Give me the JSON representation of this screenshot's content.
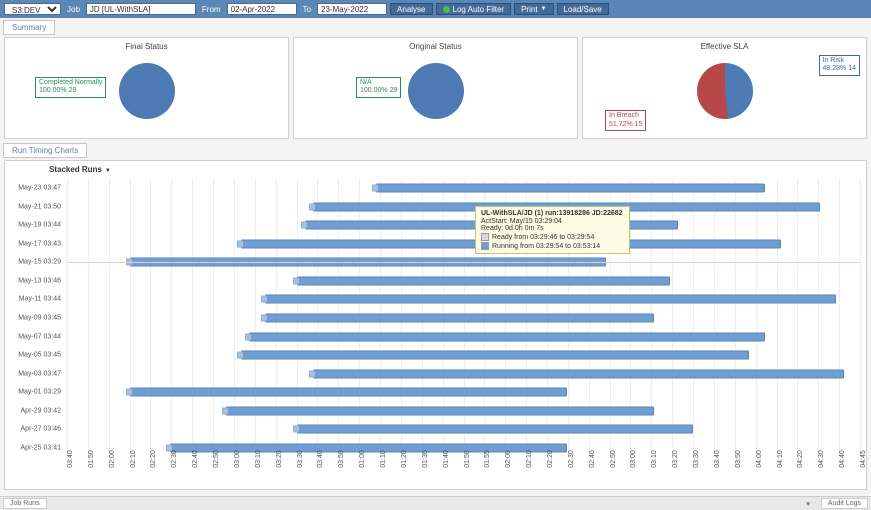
{
  "toolbar": {
    "env_value": "S3:DEV",
    "job_lbl": "Job",
    "job_value": "JD [UL-WithSLA]",
    "from_lbl": "From",
    "from_value": "02-Apr-2022",
    "to_lbl": "To",
    "to_value": "23-May-2022",
    "analyse": "Analyse",
    "autofilter": "Log Auto Filter",
    "print": "Print",
    "loadsave": "Load/Save"
  },
  "tabs": {
    "summary": "Summary",
    "runtiming": "Run Timing Charts"
  },
  "panels": {
    "final": {
      "title": "Final Status",
      "label": "Completed Normally\n100.00% 29",
      "label_color": "#2e8b57"
    },
    "original": {
      "title": "Original Status",
      "label": "N/A\n100.00% 29",
      "label_color": "#2e8b57"
    },
    "sla": {
      "title": "Effective SLA",
      "label_top": "In Risk\n48.28% 14",
      "label_top_color": "#3c68a6",
      "label_bot": "In Breach\n51.72% 15",
      "label_bot_color": "#b84848"
    }
  },
  "chart": {
    "title": "Stacked Runs"
  },
  "tooltip": {
    "title": "UL-WithSLA/JD (1) run:13918286 JD:22682",
    "l1": "ActStart: May/15 03:29:04",
    "l2": "Ready:    0d 0h 0m 7s",
    "ready": "Ready from 03:29:46 to 03:29:54",
    "running": "Running from 03:29:54 to 03:53:14"
  },
  "chart_data": {
    "type": "bar",
    "title": "Stacked Runs",
    "xlabel": "",
    "ylabel": "",
    "x_ticks": [
      "03:40",
      "01:50",
      "02:00",
      "02:10",
      "02:20",
      "02:30",
      "02:40",
      "02:50",
      "03:00",
      "03:10",
      "03:20",
      "03:30",
      "03:40",
      "03:50",
      "01:00",
      "01:10",
      "01:20",
      "01:30",
      "01:40",
      "01:50",
      "01:55",
      "02:00",
      "02:10",
      "02:20",
      "02:30",
      "02:40",
      "02:50",
      "03:00",
      "03:10",
      "03:20",
      "03:30",
      "03:40",
      "03:50",
      "04:00",
      "04:10",
      "04:20",
      "04:30",
      "04:40",
      "04:45"
    ],
    "x_range_min": 0,
    "x_range_max": 100,
    "rows": [
      {
        "label": "May-23 03:47",
        "start": 39,
        "end": 88
      },
      {
        "label": "May-21 03:50",
        "start": 31,
        "end": 95
      },
      {
        "label": "May-19 03:44",
        "start": 30,
        "end": 77
      },
      {
        "label": "May-17 03:43",
        "start": 22,
        "end": 90
      },
      {
        "label": "May-15 03:29",
        "start": 8,
        "end": 68
      },
      {
        "label": "May-13 03:46",
        "start": 29,
        "end": 76
      },
      {
        "label": "May-11 03:44",
        "start": 25,
        "end": 97
      },
      {
        "label": "May-09 03:45",
        "start": 25,
        "end": 74
      },
      {
        "label": "May-07 03:44",
        "start": 23,
        "end": 88
      },
      {
        "label": "May-05 03:45",
        "start": 22,
        "end": 86
      },
      {
        "label": "May-03 03:47",
        "start": 31,
        "end": 98
      },
      {
        "label": "May-01 03:29",
        "start": 8,
        "end": 63
      },
      {
        "label": "Apr-29 03:42",
        "start": 20,
        "end": 74
      },
      {
        "label": "Apr-27 03:46",
        "start": 29,
        "end": 79
      },
      {
        "label": "Apr-25 03:41",
        "start": 13,
        "end": 63
      }
    ],
    "highlight_row_index": 4
  },
  "bottom": {
    "left": "Job Runs",
    "right": "Audit Logs"
  }
}
